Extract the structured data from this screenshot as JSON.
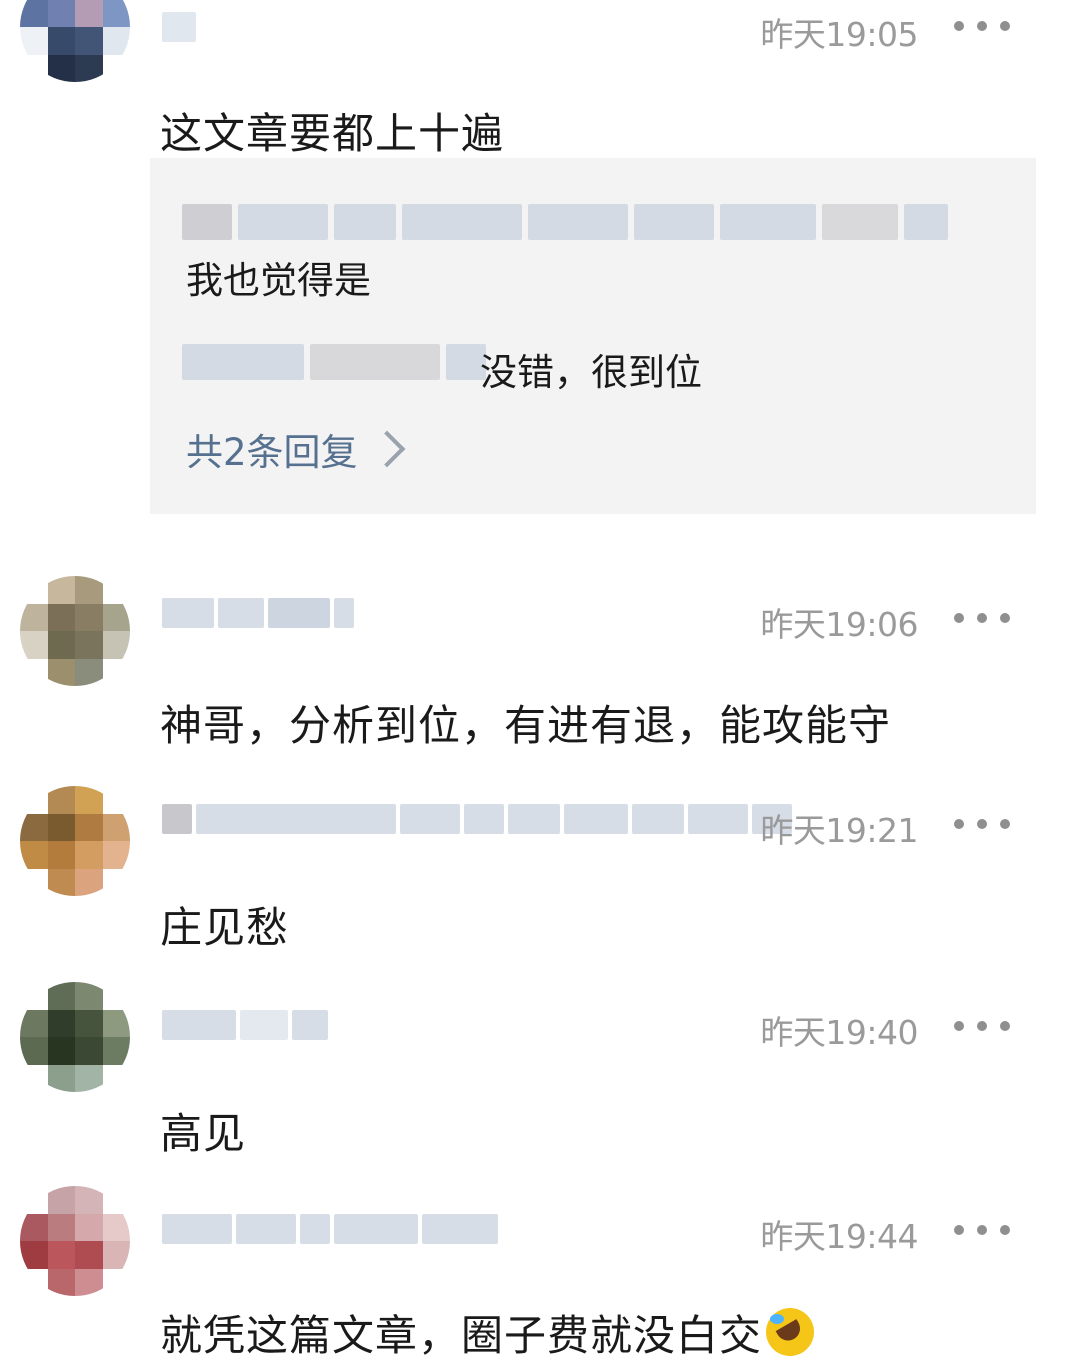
{
  "comments": [
    {
      "time": "昨天19:05",
      "text": "这文章要都上十遍",
      "replies": [
        {
          "text": "我也觉得是"
        },
        {
          "text": "没错，很到位"
        }
      ],
      "reply_count_label": "共2条回复"
    },
    {
      "time": "昨天19:06",
      "text": "神哥，分析到位，有进有退，能攻能守"
    },
    {
      "time": "昨天19:21",
      "text": "庄见愁"
    },
    {
      "time": "昨天19:40",
      "text": "高见"
    },
    {
      "time": "昨天19:44",
      "text": "就凭这篇文章，圈子费就没白交"
    }
  ]
}
